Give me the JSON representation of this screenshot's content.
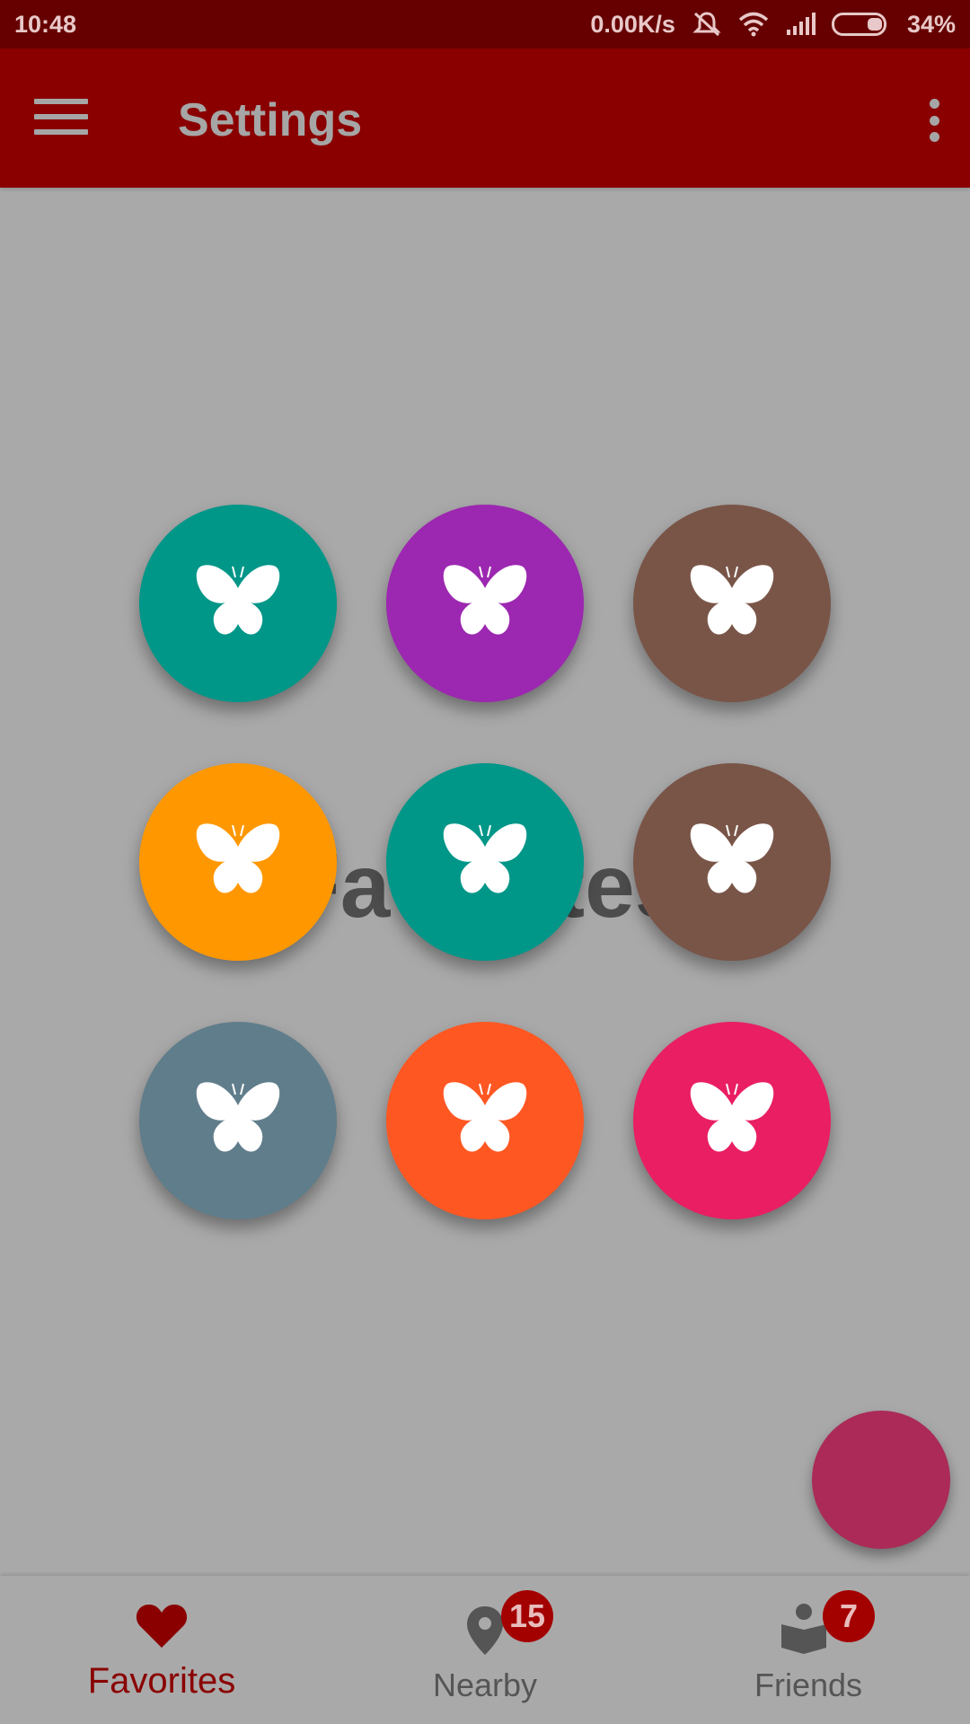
{
  "status_bar": {
    "time": "10:48",
    "speed": "0.00K/s",
    "battery": "34%",
    "icons": [
      "mute-icon",
      "wifi-icon",
      "signal-icon",
      "battery-icon"
    ]
  },
  "app_bar": {
    "title": "Settings",
    "menu_icon": "hamburger-menu-icon",
    "overflow_icon": "more-vert-icon"
  },
  "background_text": "Favorites",
  "circles": [
    {
      "color": "#009688",
      "icon": "butterfly-icon"
    },
    {
      "color": "#9c27b0",
      "icon": "butterfly-icon"
    },
    {
      "color": "#795548",
      "icon": "butterfly-icon"
    },
    {
      "color": "#ff9800",
      "icon": "butterfly-icon"
    },
    {
      "color": "#009688",
      "icon": "butterfly-icon"
    },
    {
      "color": "#795548",
      "icon": "butterfly-icon"
    },
    {
      "color": "#607d8b",
      "icon": "butterfly-icon"
    },
    {
      "color": "#ff5722",
      "icon": "butterfly-icon"
    },
    {
      "color": "#e91e63",
      "icon": "butterfly-icon"
    }
  ],
  "fab": {
    "color": "#ab2a58"
  },
  "bottom_nav": {
    "items": [
      {
        "label": "Favorites",
        "icon": "heart-icon",
        "active": true,
        "badge": ""
      },
      {
        "label": "Nearby",
        "icon": "map-pin-icon",
        "active": false,
        "badge": "15"
      },
      {
        "label": "Friends",
        "icon": "reading-person-icon",
        "active": false,
        "badge": "7"
      }
    ]
  },
  "colors": {
    "primary": "#8a0000",
    "status_bar": "#660000",
    "badge": "#a30000",
    "background": "#a9a9a9"
  }
}
